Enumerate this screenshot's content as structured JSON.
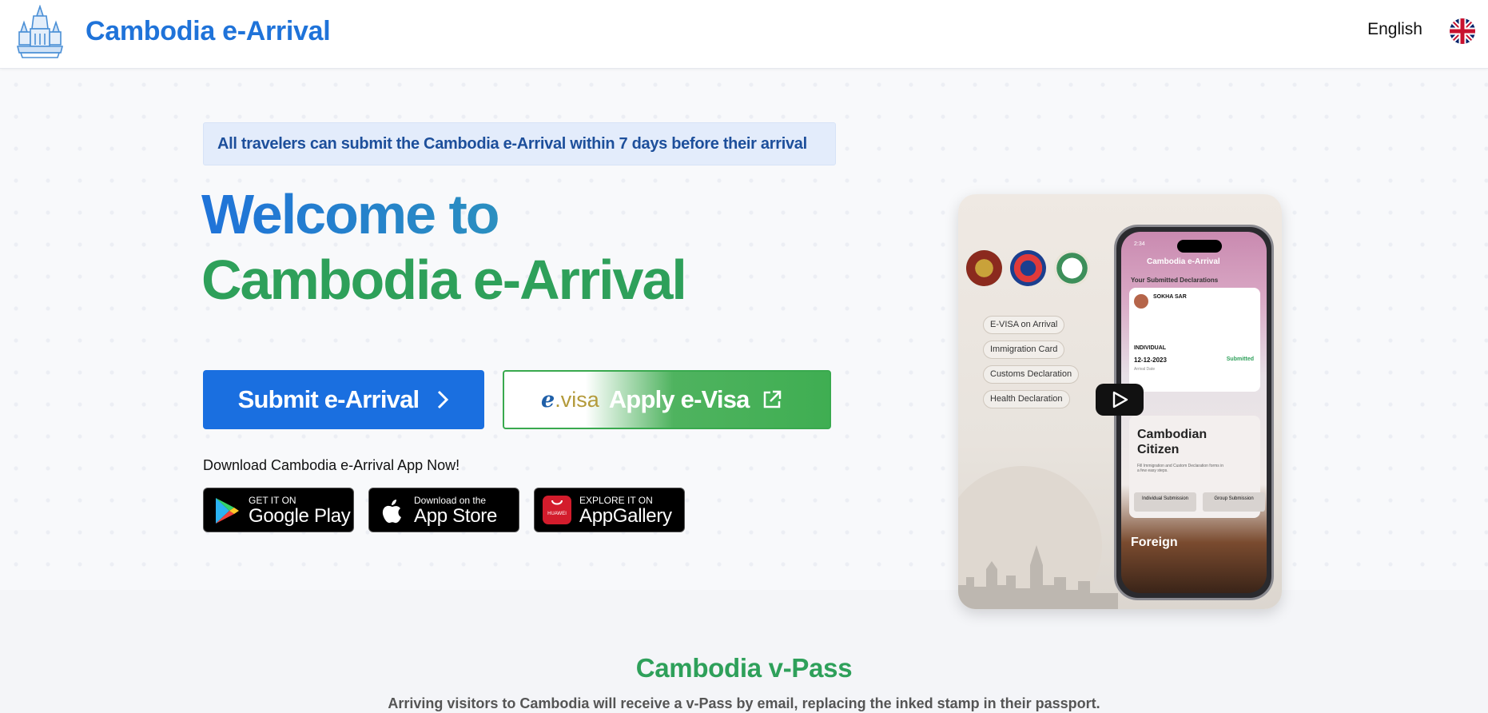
{
  "header": {
    "brand": "Cambodia e-Arrival",
    "language": "English",
    "logo_icon": "angkor-wat-emblem-icon",
    "flag_icon": "uk-flag-icon"
  },
  "hero": {
    "notice": "All travelers can submit the Cambodia e-Arrival within 7 days before their arrival",
    "welcome_line1": "Welcome to",
    "welcome_line2": "Cambodia e-Arrival",
    "submit_label": "Submit e-Arrival",
    "evisa_logo_e": "e",
    "evisa_logo_visa": ".visa",
    "evisa_label": "Apply e-Visa",
    "download_text": "Download Cambodia e-Arrival App Now!",
    "stores": [
      {
        "small": "GET IT ON",
        "big": "Google Play",
        "icon": "google-play-icon"
      },
      {
        "small": "Download on the",
        "big": "App Store",
        "icon": "apple-icon"
      },
      {
        "small": "EXPLORE IT ON",
        "big": "AppGallery",
        "icon": "huawei-icon",
        "icon_text": "HUAWEI"
      }
    ]
  },
  "video": {
    "pills": [
      "E-VISA on Arrival",
      "Immigration Card",
      "Customs Declaration",
      "Health Declaration"
    ],
    "phone": {
      "time": "2:34",
      "app_title": "Cambodia e-Arrival",
      "section": "Your Submitted Declarations",
      "name": "SOKHA SAR",
      "type": "INDIVIDUAL",
      "date": "12-12-2023",
      "status": "Submitted",
      "arrival_label": "Arrival Date",
      "citizen_title": "Cambodian Citizen",
      "citizen_desc": "Fill Immigration and Custom Declaration forms in a few easy steps.",
      "btn_individual": "Individual Submission",
      "btn_group": "Group Submission",
      "foreign": "Foreign"
    }
  },
  "vpass": {
    "title": "Cambodia v-Pass",
    "description": "Arriving visitors to Cambodia will receive a v-Pass by email, replacing the inked stamp in their passport."
  },
  "colors": {
    "primary_blue": "#1a6fe0",
    "green": "#2ea05a",
    "notice_bg": "#e3ecfb"
  }
}
